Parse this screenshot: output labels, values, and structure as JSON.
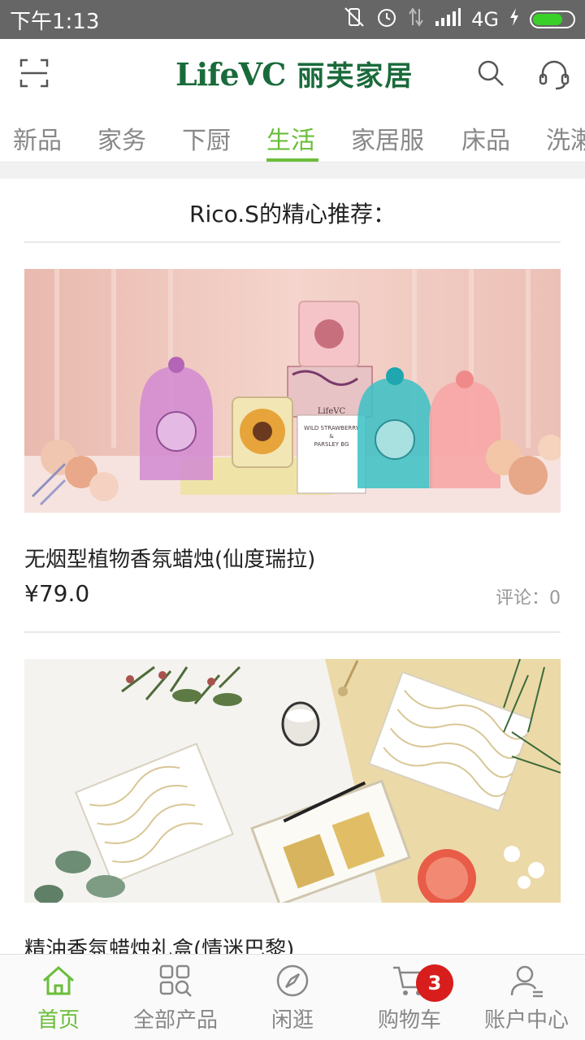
{
  "status_bar": {
    "time": "下午1:13",
    "network": "4G"
  },
  "header": {
    "logo_en": "LifeVC",
    "logo_cn": "丽芙家居"
  },
  "tabs": [
    {
      "label": "新品"
    },
    {
      "label": "家务"
    },
    {
      "label": "下厨"
    },
    {
      "label": "生活",
      "active": true
    },
    {
      "label": "家居服"
    },
    {
      "label": "床品"
    },
    {
      "label": "洗漱"
    }
  ],
  "section": {
    "title": "Rico.S的精心推荐："
  },
  "products": [
    {
      "name": "无烟型植物香氛蜡烛(仙度瑞拉)",
      "price": "¥79.0",
      "comments": "评论：0",
      "image_text": [
        "LifeVC",
        "WILD STRAWBERRY",
        "&",
        "PARSLEY BG"
      ]
    },
    {
      "name": "精油香氛蜡烛礼盒(情迷巴黎)"
    }
  ],
  "bottom_nav": [
    {
      "label": "首页",
      "icon": "home-icon",
      "active": true
    },
    {
      "label": "全部产品",
      "icon": "grid-search-icon"
    },
    {
      "label": "闲逛",
      "icon": "compass-icon"
    },
    {
      "label": "购物车",
      "icon": "cart-icon",
      "badge": "3"
    },
    {
      "label": "账户中心",
      "icon": "user-icon"
    }
  ],
  "colors": {
    "accent": "#6abe3a",
    "brand": "#1a6b3b",
    "badge": "#d81d1d"
  }
}
